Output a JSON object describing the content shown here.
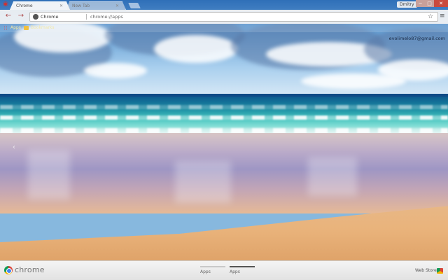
{
  "window": {
    "tabs": [
      {
        "label": "Chrome",
        "active": true
      },
      {
        "label": "New Tab",
        "active": false
      }
    ],
    "profile_label": "Dmitry",
    "controls": {
      "minimize": "−",
      "maximize": "□",
      "close": "✕"
    }
  },
  "toolbar": {
    "back": "←",
    "forward": "→",
    "site_chip": "Chrome",
    "url": "chrome://apps",
    "star": "☆",
    "menu": "≡"
  },
  "bookmarks": {
    "apps_label": "Apps",
    "bookmarks_label": "Bookmarks"
  },
  "account": {
    "email": "evolimelo87@gmail.com"
  },
  "nav": {
    "prev": "‹"
  },
  "bottom": {
    "wordmark": "chrome",
    "pages": [
      {
        "label": "Apps",
        "active": false
      },
      {
        "label": "Apps",
        "active": true
      }
    ],
    "webstore_label": "Web Store"
  },
  "colors": {
    "close_button": "#c94a3d",
    "toolbar_bg": "#f5f5f5",
    "bookmark_text": "#f2e8a8"
  }
}
